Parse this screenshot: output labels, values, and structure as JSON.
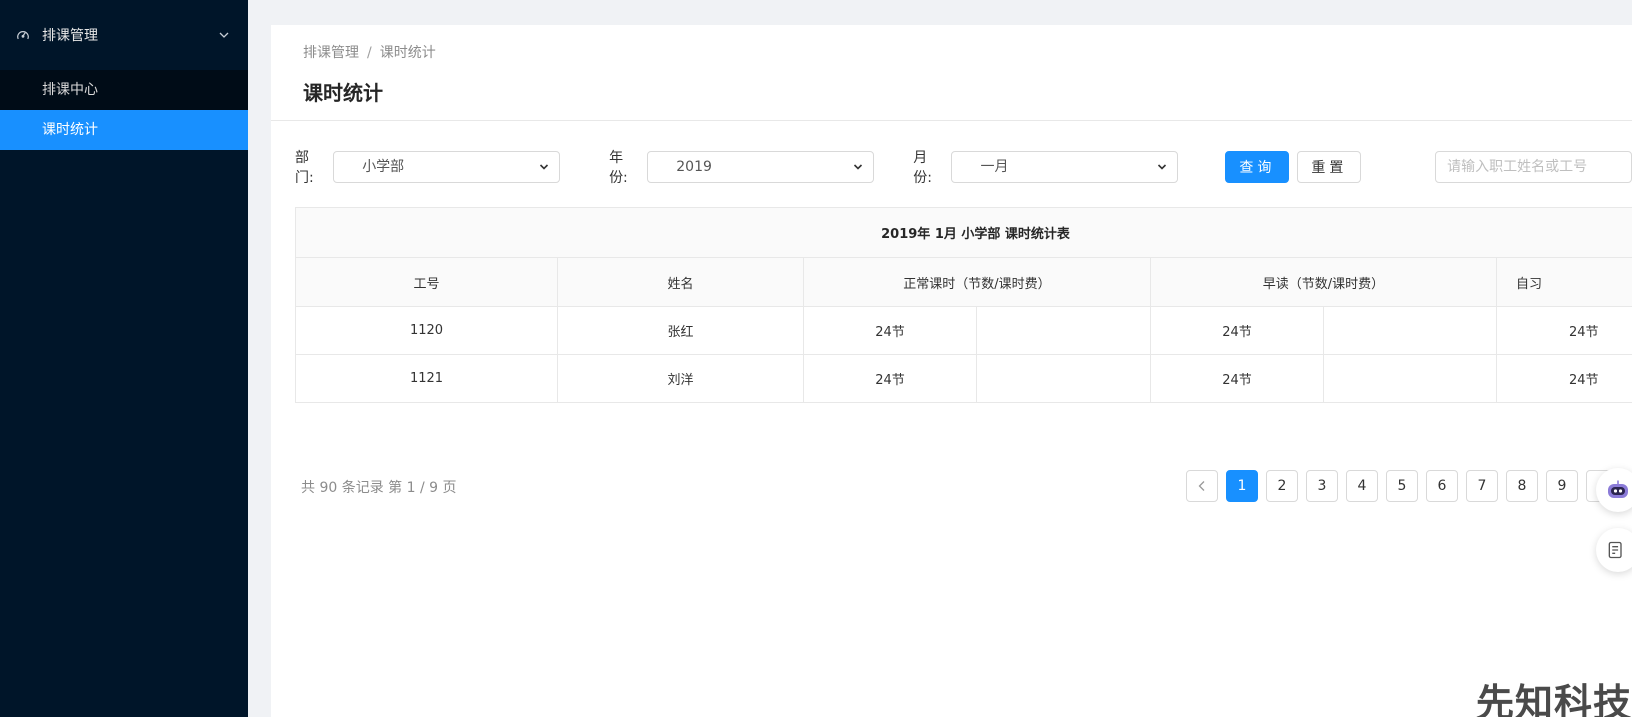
{
  "sidebar": {
    "group_label": "排课管理",
    "items": [
      {
        "label": "排课中心",
        "active": false
      },
      {
        "label": "课时统计",
        "active": true
      }
    ]
  },
  "breadcrumb": {
    "root": "排课管理",
    "separator": "/",
    "current": "课时统计"
  },
  "page": {
    "title": "课时统计"
  },
  "filters": {
    "department": {
      "label": "部门:",
      "value": "小学部"
    },
    "year": {
      "label": "年份:",
      "value": "2019"
    },
    "month": {
      "label": "月份:",
      "value": "一月"
    },
    "query_label": "查询",
    "reset_label": "重置",
    "search_placeholder": "请输入职工姓名或工号"
  },
  "table": {
    "caption": "2019年 1月 小学部 课时统计表",
    "headers": [
      "工号",
      "姓名",
      "正常课时（节数/课时费）",
      "早读（节数/课时费）",
      "自习"
    ],
    "rows": [
      {
        "id": "1120",
        "name": "张红",
        "normal": "24节",
        "normal_fee": "",
        "morning": "24节",
        "morning_fee": "",
        "study": "24节"
      },
      {
        "id": "1121",
        "name": "刘洋",
        "normal": "24节",
        "normal_fee": "",
        "morning": "24节",
        "morning_fee": "",
        "study": "24节"
      }
    ]
  },
  "pagination": {
    "summary": "共 90 条记录 第 1 / 9 页",
    "pages": [
      "1",
      "2",
      "3",
      "4",
      "5",
      "6",
      "7",
      "8",
      "9"
    ],
    "current": "1"
  },
  "watermark": "先知科技",
  "colors": {
    "sidebar_bg": "#001529",
    "primary": "#1890ff",
    "page_bg": "#f0f2f5"
  }
}
